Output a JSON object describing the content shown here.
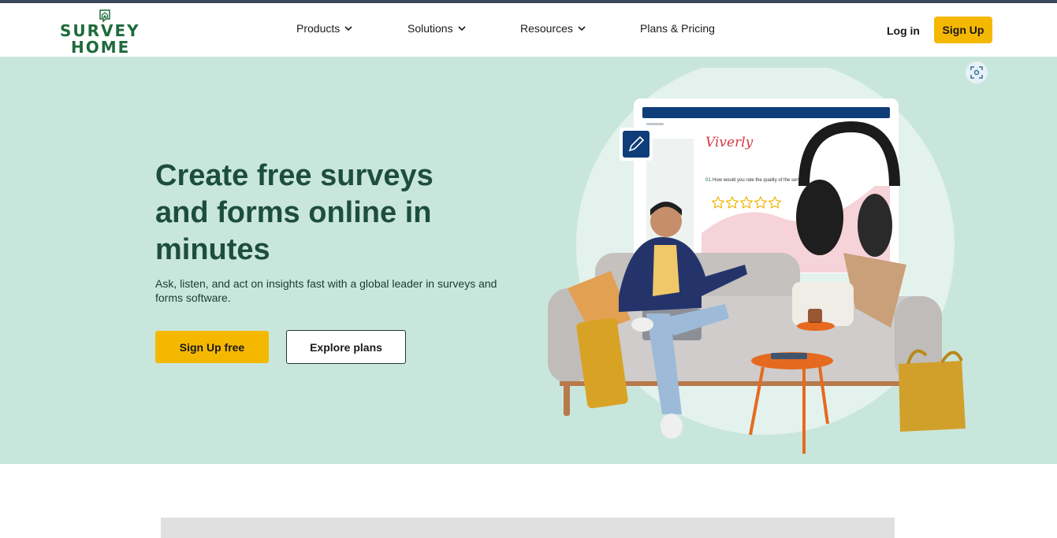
{
  "header": {
    "logo": {
      "line1": "SURVEY",
      "line2": "HOME"
    },
    "nav": [
      {
        "label": "Products",
        "has_dropdown": true
      },
      {
        "label": "Solutions",
        "has_dropdown": true
      },
      {
        "label": "Resources",
        "has_dropdown": true
      },
      {
        "label": "Plans & Pricing",
        "has_dropdown": false
      }
    ],
    "login_label": "Log in",
    "signup_label": "Sign Up"
  },
  "hero": {
    "title": "Create free surveys and forms online in minutes",
    "subtitle": "Ask, listen, and act on insights fast with a global leader in surveys and forms software.",
    "primary_cta": "Sign Up free",
    "secondary_cta": "Explore plans",
    "mock_survey": {
      "brand": "Viverly",
      "question_number": "01.",
      "question": "How would you rate the quality of the service?",
      "rating_stars": 5
    }
  },
  "icons": [
    "house-icon",
    "chevron-down-icon",
    "scan-icon",
    "pencil-icon",
    "star-icon"
  ],
  "colors": {
    "accent": "#f5b800",
    "brand_green": "#1f6b3c",
    "hero_bg": "#c9e6dc",
    "heading": "#1d4e3c",
    "mock_header": "#0f3d7a"
  }
}
